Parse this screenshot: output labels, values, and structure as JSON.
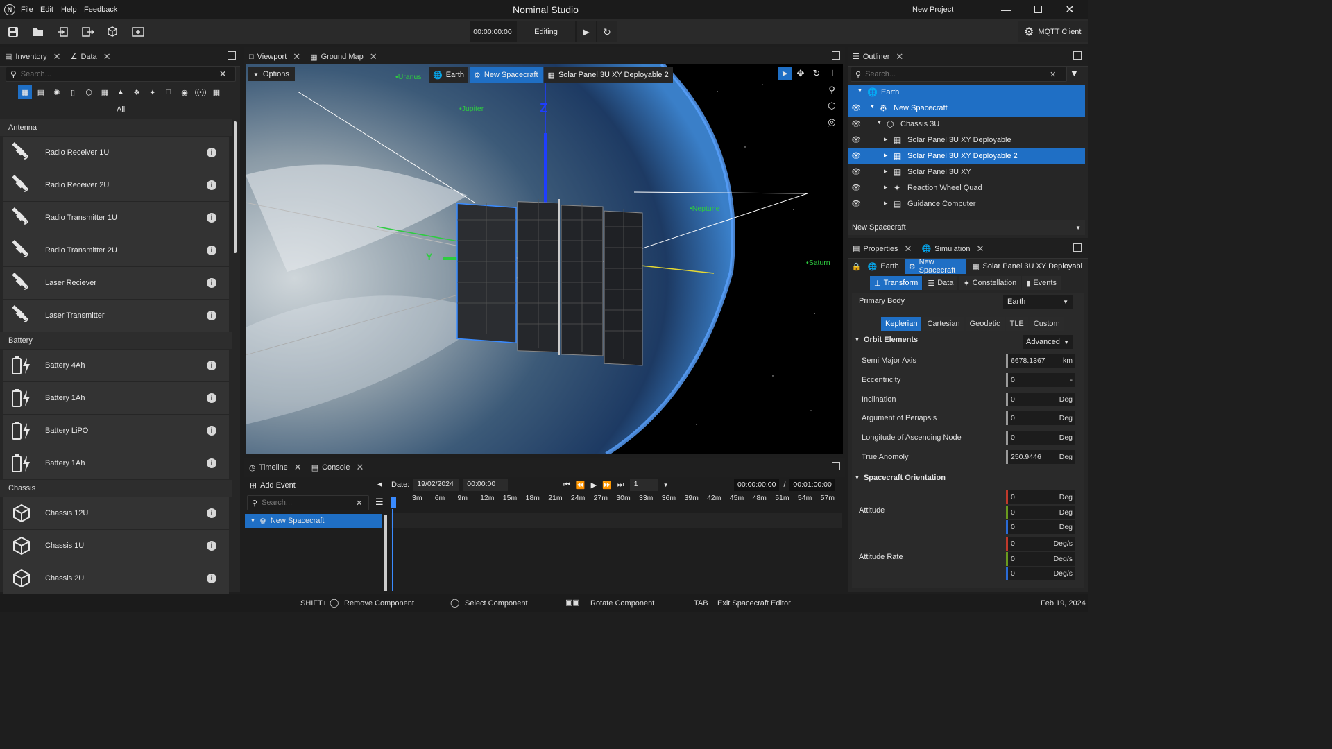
{
  "app": {
    "title": "Nominal Studio",
    "project": "New Project"
  },
  "menu": [
    "File",
    "Edit",
    "Help",
    "Feedback"
  ],
  "toolbar": {
    "time": "00:00:00:00",
    "mode": "Editing",
    "mqtt": "MQTT Client"
  },
  "inventory": {
    "tab_inventory": "Inventory",
    "tab_data": "Data",
    "search_placeholder": "Search...",
    "filter_all": "All",
    "categories": [
      {
        "name": "Antenna",
        "items": [
          "Radio Receiver 1U",
          "Radio Receiver 2U",
          "Radio Transmitter 1U",
          "Radio Transmitter 2U",
          "Laser Reciever",
          "Laser Transmitter"
        ]
      },
      {
        "name": "Battery",
        "items": [
          "Battery 4Ah",
          "Battery 1Ah",
          "Battery LiPO",
          "Battery 1Ah"
        ]
      },
      {
        "name": "Chassis",
        "items": [
          "Chassis 12U",
          "Chassis 1U",
          "Chassis 2U"
        ]
      }
    ]
  },
  "viewport": {
    "tab_viewport": "Viewport",
    "tab_groundmap": "Ground Map",
    "options": "Options",
    "breadcrumb": [
      "Earth",
      "New Spacecraft",
      "Solar Panel 3U XY Deployable 2"
    ],
    "planets": [
      "Uranus",
      "Jupiter",
      "Neptune",
      "Saturn"
    ],
    "axis_z": "Z",
    "axis_y": "Y"
  },
  "timeline": {
    "tab_timeline": "Timeline",
    "tab_console": "Console",
    "add_event": "Add Event",
    "search_placeholder": "Search...",
    "item": "New Spacecraft",
    "date_label": "Date:",
    "date": "19/02/2024",
    "time": "00:00:00",
    "speed": "1",
    "elapsed": "00:00:00:00",
    "separator": "/",
    "total": "00:01:00:00",
    "ticks": [
      "3m",
      "6m",
      "9m",
      "12m",
      "15m",
      "18m",
      "21m",
      "24m",
      "27m",
      "30m",
      "33m",
      "36m",
      "39m",
      "42m",
      "45m",
      "48m",
      "51m",
      "54m",
      "57m"
    ]
  },
  "outliner": {
    "tab": "Outliner",
    "search_placeholder": "Search...",
    "tree": [
      {
        "label": "Earth",
        "depth": 0,
        "selected": true,
        "eye": false,
        "icon": "globe-icon"
      },
      {
        "label": "New Spacecraft",
        "depth": 1,
        "selected": true,
        "eye": true,
        "icon": "satellite-icon"
      },
      {
        "label": "Chassis 3U",
        "depth": 2,
        "selected": false,
        "eye": true,
        "icon": "cube-icon"
      },
      {
        "label": "Solar Panel 3U XY Deployable",
        "depth": 3,
        "selected": false,
        "eye": true,
        "icon": "solar-panel-icon"
      },
      {
        "label": "Solar Panel 3U XY Deployable 2",
        "depth": 3,
        "selected": true,
        "eye": true,
        "icon": "solar-panel-icon"
      },
      {
        "label": "Solar Panel 3U XY",
        "depth": 3,
        "selected": false,
        "eye": true,
        "icon": "solar-panel-icon"
      },
      {
        "label": "Reaction Wheel Quad",
        "depth": 3,
        "selected": false,
        "eye": true,
        "icon": "wheel-icon"
      },
      {
        "label": "Guidance Computer",
        "depth": 3,
        "selected": false,
        "eye": true,
        "icon": "computer-icon"
      }
    ],
    "selector": "New Spacecraft"
  },
  "properties": {
    "tab_properties": "Properties",
    "tab_simulation": "Simulation",
    "breadcrumb": [
      "Earth",
      "New Spacecraft",
      "Solar Panel 3U XY Deployabl"
    ],
    "subtabs": [
      "Transform",
      "Data",
      "Constellation",
      "Events"
    ],
    "primary_body_label": "Primary Body",
    "primary_body": "Earth",
    "orbit_tabs": [
      "Keplerian",
      "Cartesian",
      "Geodetic",
      "TLE",
      "Custom"
    ],
    "orbit_elements": "Orbit Elements",
    "orbit_mode": "Advanced",
    "fields": [
      {
        "label": "Semi Major Axis",
        "value": "6678.1367",
        "unit": "km"
      },
      {
        "label": "Eccentricity",
        "value": "0",
        "unit": "-"
      },
      {
        "label": "Inclination",
        "value": "0",
        "unit": "Deg"
      },
      {
        "label": "Argument of Periapsis",
        "value": "0",
        "unit": "Deg"
      },
      {
        "label": "Longitude of Ascending Node",
        "value": "0",
        "unit": "Deg"
      },
      {
        "label": "True Anomoly",
        "value": "250.9446",
        "unit": "Deg"
      }
    ],
    "orientation": "Spacecraft Orientation",
    "attitude_label": "Attitude",
    "attitude": [
      {
        "value": "0",
        "unit": "Deg"
      },
      {
        "value": "0",
        "unit": "Deg"
      },
      {
        "value": "0",
        "unit": "Deg"
      }
    ],
    "rate_label": "Attitude Rate",
    "rate": [
      {
        "value": "0",
        "unit": "Deg/s"
      },
      {
        "value": "0",
        "unit": "Deg/s"
      },
      {
        "value": "0",
        "unit": "Deg/s"
      }
    ]
  },
  "status": {
    "shift": "SHIFT+",
    "remove": "Remove Component",
    "select": "Select Component",
    "rotate": "Rotate Component",
    "tab": "TAB",
    "exit": "Exit Spacecraft Editor",
    "date": "Feb 19, 2024"
  },
  "colors": {
    "accent": "#1f6fc5",
    "x_axis": "#c0392b",
    "y_axis": "#6a9a1f",
    "z_axis": "#2a6bd6"
  }
}
